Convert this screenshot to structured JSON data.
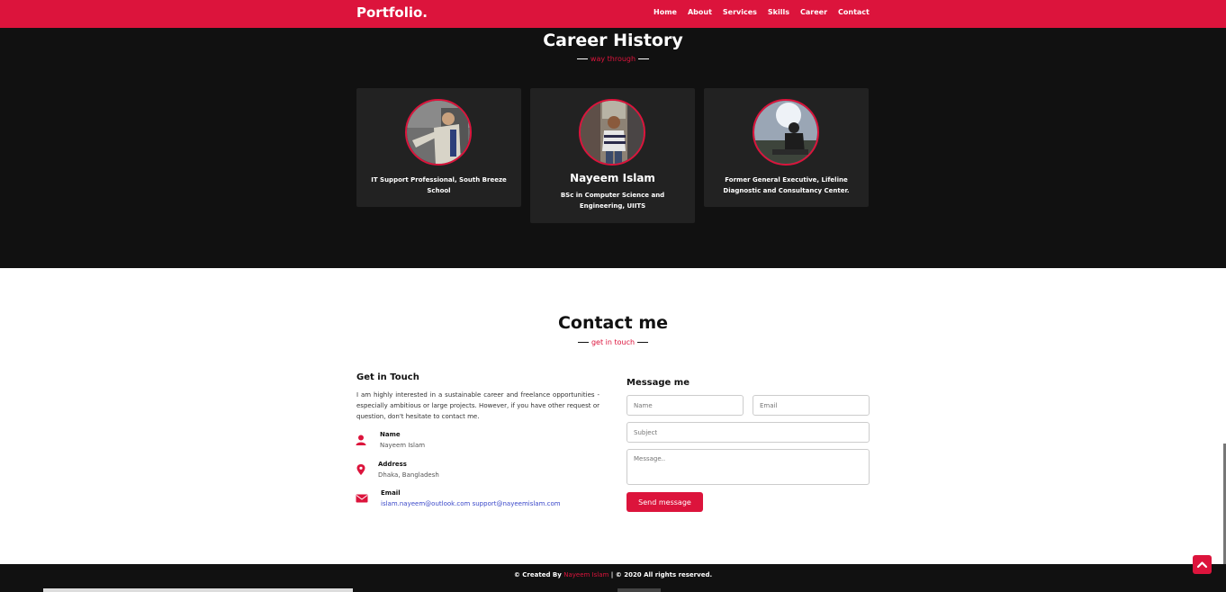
{
  "brand": "Portfolio.",
  "nav": [
    "Home",
    "About",
    "Services",
    "Skills",
    "Career",
    "Contact"
  ],
  "career": {
    "title": "Career History",
    "subtitle": "way through",
    "cards": [
      {
        "text": "IT Support Professional, South Breeze School"
      },
      {
        "name": "Nayeem Islam",
        "text": "BSc in Computer Science and Engineering, UIITS"
      },
      {
        "text": "Former General Executive, Lifeline Diagnostic and Consultancy Center."
      }
    ]
  },
  "contact": {
    "title": "Contact me",
    "subtitle": "get in touch",
    "get_in_touch": "Get in Touch",
    "intro": "I am highly interested in a sustainable career and freelance opportunities - especially ambitious or large projects. However, if you have other request or question, don't hesitate to contact me.",
    "info": [
      {
        "label": "Name",
        "value": "Nayeem Islam",
        "icon": "user-icon"
      },
      {
        "label": "Address",
        "value": "Dhaka, Bangladesh",
        "icon": "map-marker-icon"
      },
      {
        "label": "Email",
        "value": "islam.nayeem@outlook.com support@nayeemislam.com",
        "icon": "envelope-icon"
      }
    ],
    "form": {
      "heading": "Message me",
      "name_placeholder": "Name",
      "email_placeholder": "Email",
      "subject_placeholder": "Subject",
      "message_placeholder": "Message..",
      "send_label": "Send message"
    }
  },
  "footer": {
    "prefix": "© Created By",
    "author": "Nayeem Islam",
    "suffix": "| © 2020 All rights reserved."
  },
  "colors": {
    "accent": "#dc143c",
    "dark": "#111111",
    "card": "#222222"
  }
}
